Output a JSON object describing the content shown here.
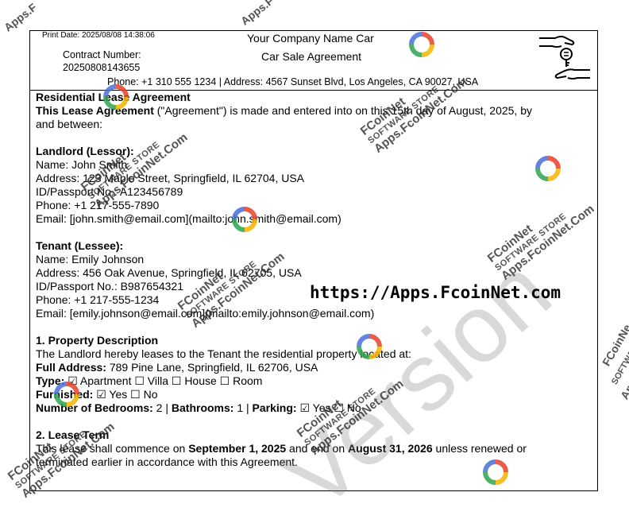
{
  "header": {
    "print_date": "Print Date: 2025/08/08 14:38:06",
    "contract_label": "Contract Number:",
    "contract_number": "20250808143655",
    "company_name": "Your Company Name Car",
    "agreement_title": "Car Sale Agreement",
    "contact": "Phone: +1 310 555 1234 | Address: 4567 Sunset Blvd, Los Angeles, CA 90027, USA",
    "logo_icon": "hand-with-key-icon"
  },
  "agreement": {
    "title": "Residential Lease Agreement",
    "intro_bold": "This Lease Agreement",
    "intro_rest": " (\"Agreement\") is made and entered into on this 15th day of August, 2025, by",
    "intro_line2": "and between:"
  },
  "landlord": {
    "heading": "Landlord (Lessor):",
    "name": "Name: John Smith",
    "address": "Address: 123 Maple Street, Springfield, IL 62704, USA",
    "id": "ID/Passport No.: A123456789",
    "phone": "Phone: +1 217-555-7890",
    "email": "Email: [john.smith@email.com](mailto:john.smith@email.com)"
  },
  "tenant": {
    "heading": "Tenant (Lessee):",
    "name": "Name: Emily Johnson",
    "address": "Address: 456 Oak Avenue, Springfield, IL 62705, USA",
    "id": "ID/Passport No.: B987654321",
    "phone": "Phone: +1 217-555-1234",
    "email": "Email: [emily.johnson@email.com](mailto:emily.johnson@email.com)"
  },
  "property": {
    "heading": "1. Property Description",
    "description": "The Landlord hereby leases to the Tenant the residential property located at:",
    "full_address_label": "Full Address:",
    "full_address_value": " 789 Pine Lane, Springfield, IL 62706, USA",
    "type_label": "Type:",
    "type_value": " ☑ Apartment ☐ Villa ☐ House ☐ Room",
    "furnished_label": "Furnished:",
    "furnished_value": " ☑ Yes ☐ No",
    "bedrooms_label": "Number of Bedrooms:",
    "bedrooms_value": " 2 | ",
    "bathrooms_label": "Bathrooms:",
    "bathrooms_value": " 1 | ",
    "parking_label": "Parking:",
    "parking_value": " ☑ Yes ☐ No"
  },
  "lease_term": {
    "heading": "2. Lease Term",
    "line1_a": "This lease shall commence on ",
    "line1_start": "September 1, 2025",
    "line1_b": " and end on ",
    "line1_end": "August 31, 2026",
    "line1_c": " unless renewed or",
    "line2": "terminated earlier in accordance with this Agreement."
  },
  "watermark": {
    "brand": "FCoinNet",
    "store": "SOFTWARE STORE",
    "site": "Apps.FcoinNet.Com",
    "version": "Version",
    "url": "https://Apps.FcoinNet.com",
    "edge_top": "Apps.F",
    "edge_right_1": "FCoinNe",
    "edge_right_2": "SOFTWARE",
    "edge_right_3": "Apps.F",
    "logo_icon": "fcoinnet-logo-icon"
  },
  "colors": {
    "logo_red": "#e8412c",
    "logo_yellow": "#f4b400",
    "logo_green": "#2ea44f",
    "logo_blue": "#4a6fd8"
  }
}
